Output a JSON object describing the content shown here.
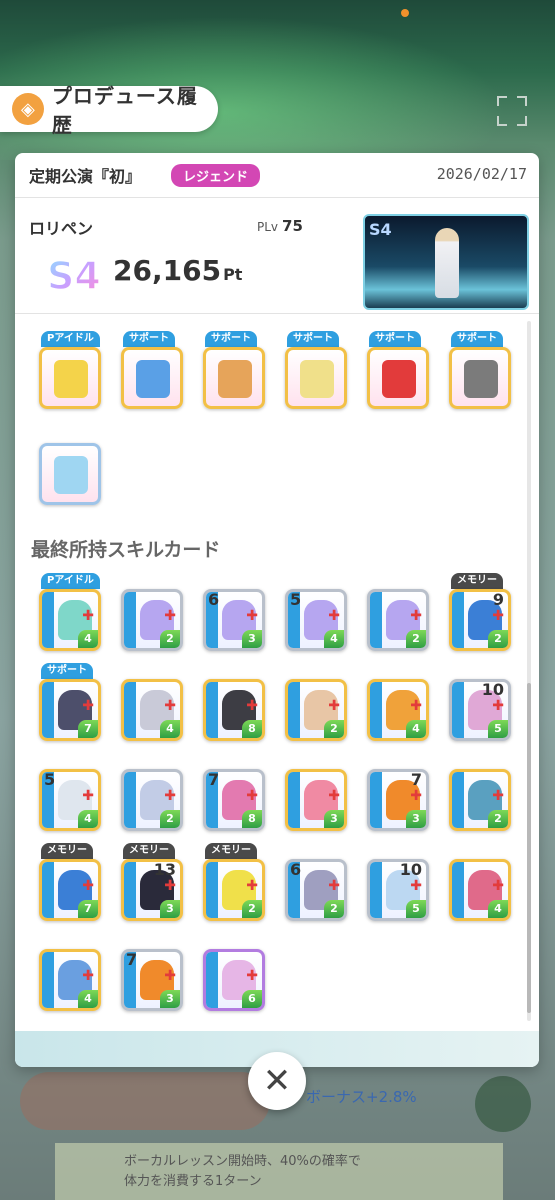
{
  "header": {
    "title": "プロデュース履歴"
  },
  "record": {
    "stage": "定期公演『初』",
    "difficulty": "レジェンド",
    "date": "2026/02/17",
    "producer_name": "ロリペン",
    "plv_label": "PLv",
    "plv_value": "75",
    "rank": "S4",
    "score": "26,165",
    "score_unit": "Pt"
  },
  "items": [
    {
      "tag": "Pアイドル",
      "kind": "penlight",
      "color": "#f4d34a"
    },
    {
      "tag": "サポート",
      "kind": "drinks",
      "color": "#5aa0e6"
    },
    {
      "tag": "サポート",
      "kind": "meal",
      "color": "#e6a45a"
    },
    {
      "tag": "サポート",
      "kind": "flowers",
      "color": "#f0e08a"
    },
    {
      "tag": "サポート",
      "kind": "basket",
      "color": "#e23b3b"
    },
    {
      "tag": "サポート",
      "kind": "notebook",
      "color": "#7b7b7b"
    },
    {
      "tag": "",
      "kind": "plush",
      "color": "#9fd6f2"
    }
  ],
  "skills_section": {
    "title": "最終所持スキルカード"
  },
  "skill_cards": [
    {
      "tag": "Pアイドル",
      "enh": "",
      "cost": "4",
      "edge": "gold",
      "art": "#7fd7c9"
    },
    {
      "tag": "",
      "enh": "",
      "cost": "2",
      "edge": "silver",
      "art": "#b6a6f0"
    },
    {
      "tag": "",
      "enh": "6",
      "cost": "3",
      "edge": "silver",
      "art": "#b6a6f0"
    },
    {
      "tag": "",
      "enh": "5",
      "cost": "4",
      "edge": "silver",
      "art": "#b6a6f0"
    },
    {
      "tag": "",
      "enh": "",
      "cost": "2",
      "edge": "silver",
      "art": "#b6a6f0"
    },
    {
      "tag": "メモリー",
      "enh": "9",
      "cost": "2",
      "edge": "gold",
      "art": "#3b7fd6"
    },
    {
      "tag": "サポート",
      "enh": "",
      "cost": "7",
      "edge": "gold",
      "art": "#4d4f6b"
    },
    {
      "tag": "",
      "enh": "",
      "cost": "4",
      "edge": "gold",
      "art": "#c9cad8"
    },
    {
      "tag": "",
      "enh": "",
      "cost": "8",
      "edge": "gold",
      "art": "#3d3d44"
    },
    {
      "tag": "",
      "enh": "",
      "cost": "2",
      "edge": "gold",
      "art": "#e8c6a6"
    },
    {
      "tag": "",
      "enh": "",
      "cost": "4",
      "edge": "gold",
      "art": "#f0a23a"
    },
    {
      "tag": "",
      "enh": "10",
      "cost": "5",
      "edge": "silver",
      "art": "#e0a8d6"
    },
    {
      "tag": "",
      "enh": "5",
      "cost": "4",
      "edge": "gold",
      "art": "#dfe6ee"
    },
    {
      "tag": "",
      "enh": "",
      "cost": "2",
      "edge": "silver",
      "art": "#c2cce6"
    },
    {
      "tag": "",
      "enh": "7",
      "cost": "8",
      "edge": "silver",
      "art": "#e37ab0"
    },
    {
      "tag": "",
      "enh": "",
      "cost": "3",
      "edge": "gold",
      "art": "#f08aa3"
    },
    {
      "tag": "",
      "enh": "7",
      "cost": "3",
      "edge": "silver",
      "art": "#f08a2b"
    },
    {
      "tag": "",
      "enh": "",
      "cost": "2",
      "edge": "gold",
      "art": "#5aa0c0"
    },
    {
      "tag": "メモリー",
      "enh": "",
      "cost": "7",
      "edge": "gold",
      "art": "#3b7fd6"
    },
    {
      "tag": "メモリー",
      "enh": "13",
      "cost": "3",
      "edge": "gold",
      "art": "#2a2a3a"
    },
    {
      "tag": "メモリー",
      "enh": "",
      "cost": "2",
      "edge": "gold",
      "art": "#f0e04a"
    },
    {
      "tag": "",
      "enh": "6",
      "cost": "2",
      "edge": "silver",
      "art": "#9f9fc0"
    },
    {
      "tag": "",
      "enh": "10",
      "cost": "5",
      "edge": "silver",
      "art": "#bcd8f2"
    },
    {
      "tag": "",
      "enh": "",
      "cost": "4",
      "edge": "gold",
      "art": "#e06a8a"
    },
    {
      "tag": "",
      "enh": "",
      "cost": "4",
      "edge": "gold",
      "art": "#6a9fe0"
    },
    {
      "tag": "",
      "enh": "7",
      "cost": "3",
      "edge": "silver",
      "art": "#f08a2b"
    },
    {
      "tag": "",
      "enh": "",
      "cost": "6",
      "edge": "purple",
      "art": "#e6b6e6"
    }
  ],
  "background_ui": {
    "bonus_text": "ボーナス+2.8%",
    "notify_line1": "ボーカルレッスン開始時、40%の確率で",
    "notify_line2": "体力を消費する1ターン"
  },
  "colors": {
    "accent_orange": "#f2a140",
    "legend_badge": "#d347b4",
    "tag_blue": "#2f9fe0"
  }
}
